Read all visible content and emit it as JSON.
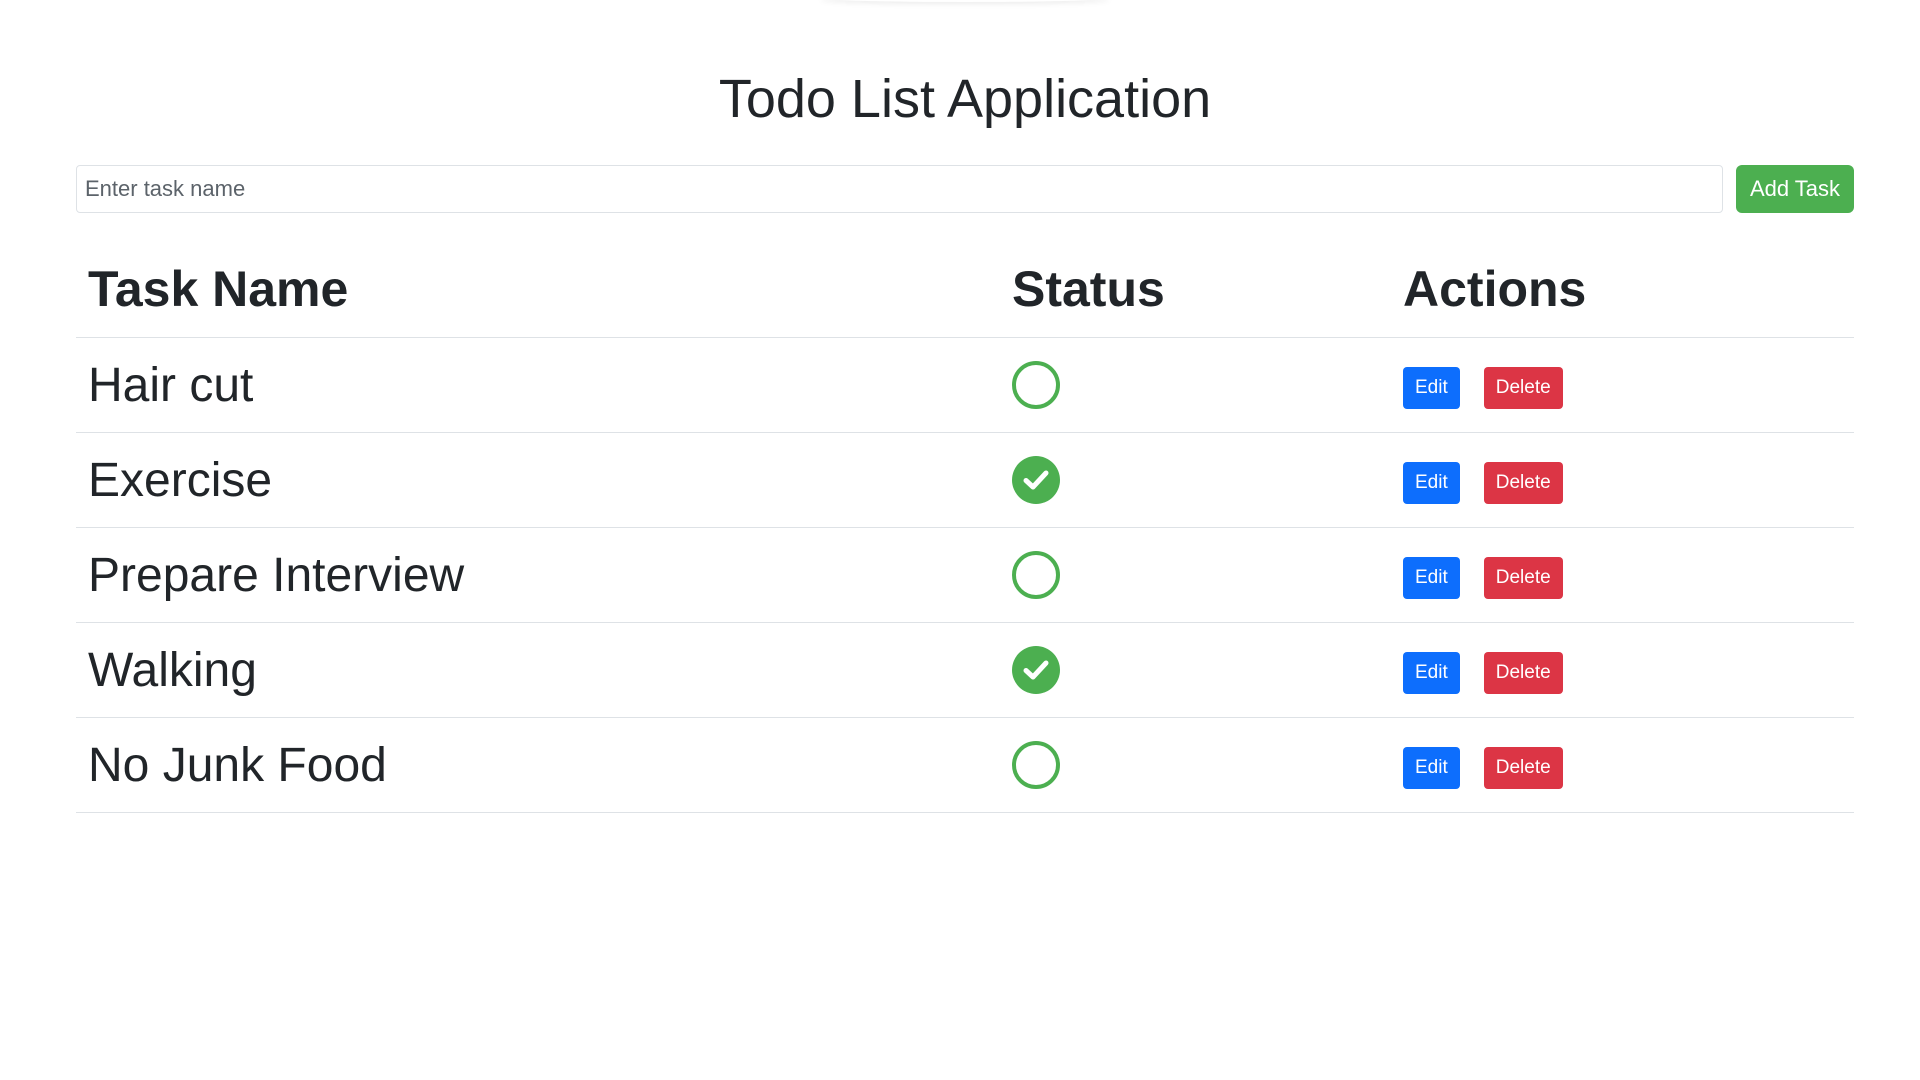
{
  "header": {
    "title": "Todo List Application"
  },
  "add_form": {
    "placeholder": "Enter task name",
    "value": "",
    "add_label": "Add Task"
  },
  "table": {
    "columns": [
      "Task Name",
      "Status",
      "Actions"
    ],
    "rows": [
      {
        "name": "Hair cut",
        "completed": false,
        "status_icon": "circle-outline-icon",
        "edit_label": "Edit",
        "delete_label": "Delete"
      },
      {
        "name": "Exercise",
        "completed": true,
        "status_icon": "check-circle-icon",
        "edit_label": "Edit",
        "delete_label": "Delete"
      },
      {
        "name": "Prepare Interview",
        "completed": false,
        "status_icon": "circle-outline-icon",
        "edit_label": "Edit",
        "delete_label": "Delete"
      },
      {
        "name": "Walking",
        "completed": true,
        "status_icon": "check-circle-icon",
        "edit_label": "Edit",
        "delete_label": "Delete"
      },
      {
        "name": "No Junk Food",
        "completed": false,
        "status_icon": "circle-outline-icon",
        "edit_label": "Edit",
        "delete_label": "Delete"
      }
    ]
  },
  "colors": {
    "success": "#4caf50",
    "edit": "#0d6efd",
    "delete": "#dc3545"
  }
}
